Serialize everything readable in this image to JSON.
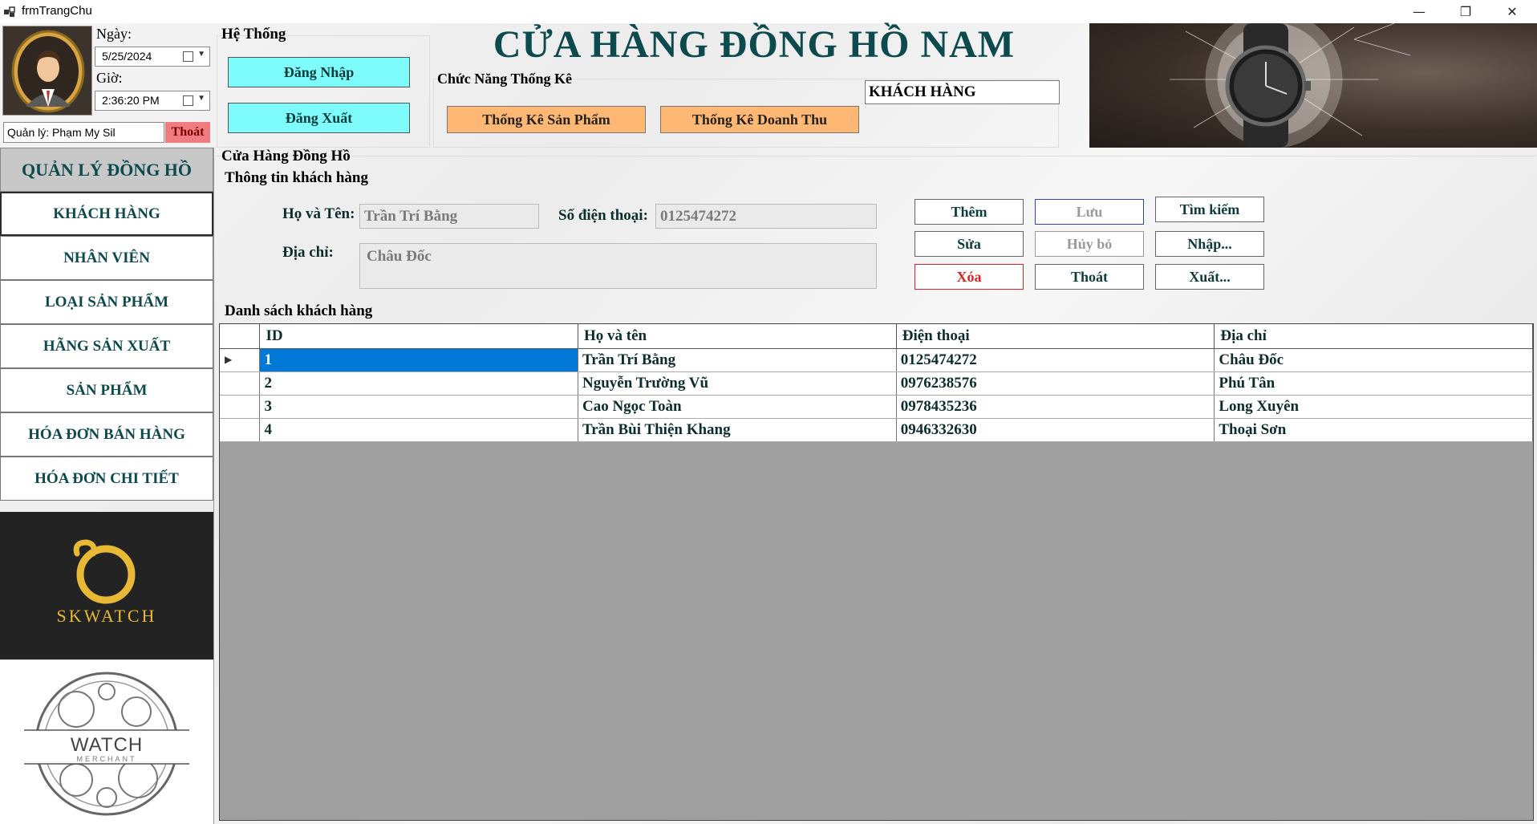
{
  "window": {
    "title": "frmTrangChu",
    "minimize": "—",
    "maximize": "❐",
    "close": "✕"
  },
  "header": {
    "date_label": "Ngày:",
    "date_value": "5/25/2024",
    "time_label": "Giờ:",
    "time_value": "2:36:20 PM",
    "manager_value": "Quản lý: Phạm My Sil",
    "logout_label": "Thoát",
    "system_group_title": "Hệ Thống",
    "login_label": "Đăng Nhập",
    "signout_label": "Đăng Xuất",
    "store_title": "CỬA HÀNG ĐỒNG HỒ NAM",
    "stats_group_title": "Chức Năng Thống Kê",
    "stats_products_label": "Thống Kê Sản Phẩm",
    "stats_revenue_label": "Thống Kê Doanh Thu",
    "current_section": "KHÁCH HÀNG"
  },
  "sidebar": {
    "header": "QUẢN LÝ ĐỒNG HỒ",
    "items": [
      {
        "label": "KHÁCH HÀNG",
        "active": true
      },
      {
        "label": "NHÂN VIÊN"
      },
      {
        "label": "LOẠI SẢN PHẨM"
      },
      {
        "label": "HÃNG SẢN XUẤT"
      },
      {
        "label": "SẢN PHẨM"
      },
      {
        "label": "HÓA ĐƠN BÁN HÀNG"
      },
      {
        "label": "HÓA ĐƠN CHI TIẾT"
      }
    ],
    "logo1_text": "SKWATCH",
    "logo2_text": "WATCH",
    "logo2_sub": "MERCHANT"
  },
  "content": {
    "group_title": "Cửa Hàng Đồng Hồ",
    "info_title": "Thông tin khách hàng",
    "name_label": "Họ và Tên:",
    "name_value": "Trần Trí Bằng",
    "phone_label": "Số điện thoại:",
    "phone_value": "0125474272",
    "address_label": "Địa chỉ:",
    "address_value": "Châu Đốc",
    "buttons": {
      "add": "Thêm",
      "save": "Lưu",
      "search": "Tìm kiếm",
      "edit": "Sửa",
      "cancel": "Hủy bỏ",
      "import": "Nhập...",
      "delete": "Xóa",
      "exit": "Thoát",
      "export": "Xuất..."
    },
    "list_title": "Danh sách khách hàng"
  },
  "table": {
    "columns": [
      "ID",
      "Họ và tên",
      "Điện thoại",
      "Địa chỉ"
    ],
    "rows": [
      [
        "1",
        "Trần Trí Bằng",
        "0125474272",
        "Châu Đốc"
      ],
      [
        "2",
        "Nguyễn Trường Vũ",
        "0976238576",
        "Phú Tân"
      ],
      [
        "3",
        "Cao Ngọc Toàn",
        "0978435236",
        "Long Xuyên"
      ],
      [
        "4",
        "Trần Bùi Thiện Khang",
        "0946332630",
        "Thoại Sơn"
      ]
    ],
    "row_indicator": "▶"
  },
  "colors": {
    "accent_teal": "#0d4a4d",
    "cyan_button": "#7efcfc",
    "orange_button": "#ffb873",
    "logout_red": "#ee7c80",
    "selection_blue": "#0078d7",
    "logo_gold": "#e8b935"
  }
}
